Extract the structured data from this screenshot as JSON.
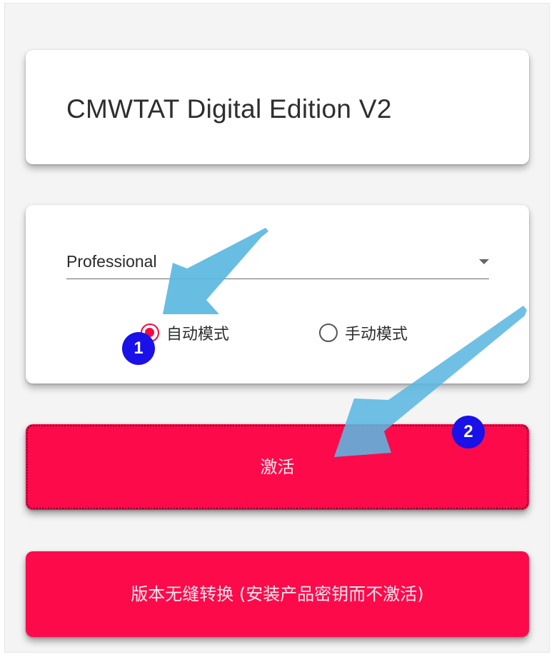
{
  "header": {
    "title": "CMWTAT Digital Edition V2"
  },
  "edition_select": {
    "selected": "Professional",
    "caret_icon": "caret-down-icon"
  },
  "mode_options": [
    {
      "label": "自动模式",
      "checked": true
    },
    {
      "label": "手动模式",
      "checked": false
    }
  ],
  "buttons": {
    "activate_label": "激活",
    "convert_label": "版本无缝转换 (安装产品密钥而不激活)"
  },
  "annotations": {
    "badge_1": "1",
    "badge_2": "2",
    "arrow_color": "#5bb7e0",
    "badge_color": "#1a10e8"
  },
  "colors": {
    "accent": "#fd0a4b",
    "radio_checked": "#f5093f"
  }
}
